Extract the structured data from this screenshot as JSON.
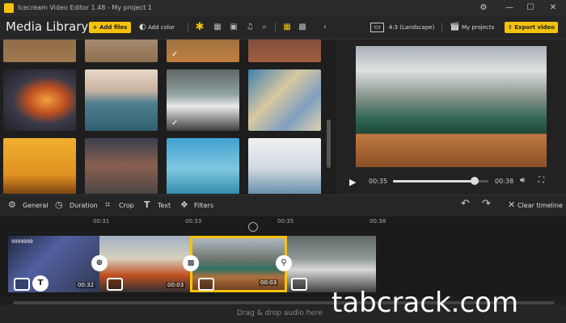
{
  "window": {
    "title": "Icecream Video Editor 1.48  -  My project 1"
  },
  "toolbar": {
    "media_title": "Media Library",
    "add_files": "+ Add files",
    "add_color": "Add color",
    "aspect": "4:3 (Landscape)",
    "my_projects": "My projects",
    "export": "Export video"
  },
  "player": {
    "current_time": "00:35",
    "end_time": "00:38",
    "progress": 0.86
  },
  "edit_tools": {
    "general": "General",
    "duration": "Duration",
    "crop": "Crop",
    "text": "Text",
    "filters": "Filters",
    "clear": "Clear timeline"
  },
  "ruler": {
    "ticks": [
      "00:31",
      "00:33",
      "00:35",
      "00:38"
    ]
  },
  "timeline": {
    "clip1_duration": "00:32",
    "clip2_duration": "00:03",
    "clip3_duration": "00:03",
    "overlay_text": "9999999"
  },
  "audio_track": {
    "placeholder": "Drag & drop audio here"
  },
  "watermark": "tabcrack.com",
  "colors": {
    "accent": "#f4c20d"
  }
}
